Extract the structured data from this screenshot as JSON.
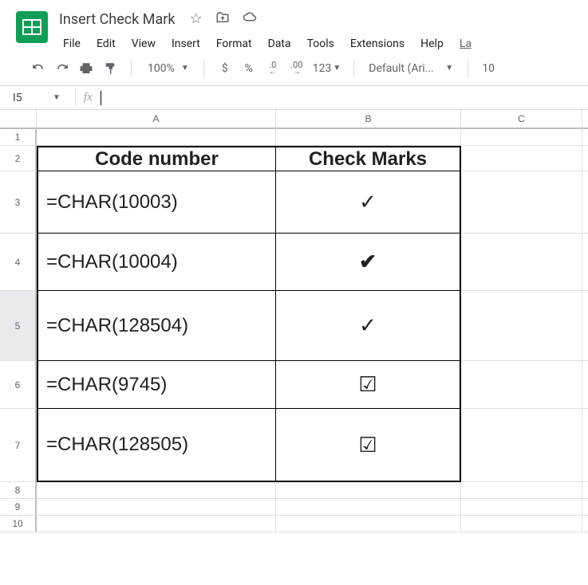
{
  "doc_title": "Insert Check Mark",
  "menus": {
    "file": "File",
    "edit": "Edit",
    "view": "View",
    "insert": "Insert",
    "format": "Format",
    "data": "Data",
    "tools": "Tools",
    "extensions": "Extensions",
    "help": "Help",
    "last": "La"
  },
  "toolbar": {
    "zoom": "100%",
    "currency": "$",
    "percent": "%",
    "dec_dec": ".0",
    "dec_inc": ".00",
    "numfmt": "123",
    "font": "Default (Ari...",
    "font_size": "10"
  },
  "formula": {
    "cell_ref": "I5",
    "fx_label": "fx"
  },
  "columns": {
    "A": "A",
    "B": "B",
    "C": "C"
  },
  "rows": {
    "1": "1",
    "2": "2",
    "3": "3",
    "4": "4",
    "5": "5",
    "6": "6",
    "7": "7",
    "8": "8",
    "9": "9",
    "10": "10"
  },
  "table": {
    "header": {
      "code": "Code number",
      "marks": "Check Marks"
    },
    "r3": {
      "code": "=CHAR(10003)",
      "mark": "✓"
    },
    "r4": {
      "code": "=CHAR(10004)",
      "mark": "✔"
    },
    "r5": {
      "code": "=CHAR(128504)",
      "mark": "✓"
    },
    "r6": {
      "code": "=CHAR(9745)",
      "mark": "☑"
    },
    "r7": {
      "code": "=CHAR(128505)",
      "mark": "☑"
    }
  }
}
